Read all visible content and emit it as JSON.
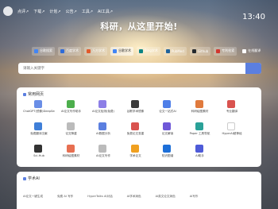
{
  "nav": {
    "items": [
      "点评↗",
      "下载↗",
      "计划↗",
      "公告↗",
      "工具↗",
      "AI工具↗"
    ]
  },
  "clock": "13:40",
  "hero_title": "科研，从这里开始!",
  "search_tabs": [
    {
      "label": "谷歌搜索",
      "color": "#4285f4",
      "active": false
    },
    {
      "label": "百度学术",
      "color": "#2f6bd8",
      "active": false
    },
    {
      "label": "万方学术",
      "color": "#e25a2b",
      "active": false
    },
    {
      "label": "谷歌学术",
      "color": "#4285f4",
      "active": true
    },
    {
      "label": "Bing学术",
      "color": "#0c8484",
      "active": false
    },
    {
      "label": "PubMed",
      "color": "#20639b",
      "active": false
    },
    {
      "label": "Github",
      "color": "#24292e",
      "active": false
    },
    {
      "label": "专利检索",
      "color": "#d1372f",
      "active": false
    },
    {
      "label": "在线翻译",
      "color": "#ffffff",
      "active": false
    }
  ],
  "search": {
    "placeholder": "请输入关键字"
  },
  "common_sites": {
    "title": "常用网页",
    "items": [
      {
        "label": "ChatGPT(镜像)DeepSeek",
        "icon": "chatgpt-icon",
        "color": "#6a8ee6"
      },
      {
        "label": "AI论文写作助手",
        "icon": "pen-icon",
        "color": "#4cae4c"
      },
      {
        "label": "AI论文检测(免费)",
        "icon": "check-icon",
        "color": "#8c7ee6"
      },
      {
        "label": "谷歌学术镜像",
        "icon": "google-icon",
        "color": "#3a3a3a"
      },
      {
        "label": "论文一站式AI",
        "icon": "triangle-icon",
        "color": "#4f7fe8"
      },
      {
        "label": "科研绘图素材",
        "icon": "image-icon",
        "color": "#e07a3d"
      },
      {
        "label": "专业翻译",
        "icon": "translate-icon",
        "color": "#d9534f"
      },
      {
        "label": "免费翻译文献",
        "icon": "book-icon",
        "color": "#3f7fd8"
      },
      {
        "label": "论文降重",
        "icon": "doc-icon",
        "color": "#bbbbbb"
      },
      {
        "label": "AI数据分析",
        "icon": "chart-icon",
        "color": "#5b7fe0"
      },
      {
        "label": "免费论文查重",
        "icon": "search-doc-icon",
        "color": "#d9534f"
      },
      {
        "label": "论文解读",
        "icon": "read-icon",
        "color": "#6f58d8"
      },
      {
        "label": "Paper 工具导航",
        "icon": "compass-icon",
        "color": "#2aa198"
      },
      {
        "label": "HyperAI超神经",
        "icon": "hyper-icon",
        "color": "#ffffff"
      },
      {
        "label": "Sci-Hub",
        "icon": "scihub-icon",
        "color": "#333333"
      },
      {
        "label": "科研绘图素材",
        "icon": "palette-icon",
        "color": "#e76f51"
      },
      {
        "label": "AI论文写作",
        "icon": "doc-icon-2",
        "color": "#bbbbbb"
      },
      {
        "label": "学术论文",
        "icon": "trophy-icon",
        "color": "#f0a020"
      },
      {
        "label": "知识图谱",
        "icon": "tree-icon",
        "color": "#1d6fd8"
      },
      {
        "label": "AI助手",
        "icon": "bird-icon",
        "color": "#4e5bd8"
      }
    ]
  },
  "ai_section": {
    "title": "学术AI",
    "items": [
      "AI论文一键生成",
      "免费 AI 写作",
      "HyperTalks AI对话",
      "AI学术润色",
      "AI英文论文润色",
      "AI写作"
    ]
  }
}
